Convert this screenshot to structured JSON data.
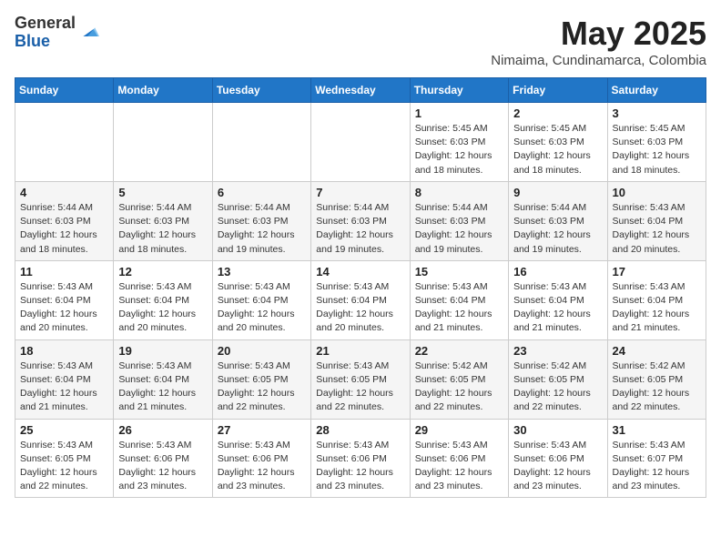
{
  "logo": {
    "general": "General",
    "blue": "Blue"
  },
  "title": "May 2025",
  "location": "Nimaima, Cundinamarca, Colombia",
  "weekdays": [
    "Sunday",
    "Monday",
    "Tuesday",
    "Wednesday",
    "Thursday",
    "Friday",
    "Saturday"
  ],
  "weeks": [
    [
      {
        "day": "",
        "detail": ""
      },
      {
        "day": "",
        "detail": ""
      },
      {
        "day": "",
        "detail": ""
      },
      {
        "day": "",
        "detail": ""
      },
      {
        "day": "1",
        "detail": "Sunrise: 5:45 AM\nSunset: 6:03 PM\nDaylight: 12 hours\nand 18 minutes."
      },
      {
        "day": "2",
        "detail": "Sunrise: 5:45 AM\nSunset: 6:03 PM\nDaylight: 12 hours\nand 18 minutes."
      },
      {
        "day": "3",
        "detail": "Sunrise: 5:45 AM\nSunset: 6:03 PM\nDaylight: 12 hours\nand 18 minutes."
      }
    ],
    [
      {
        "day": "4",
        "detail": "Sunrise: 5:44 AM\nSunset: 6:03 PM\nDaylight: 12 hours\nand 18 minutes."
      },
      {
        "day": "5",
        "detail": "Sunrise: 5:44 AM\nSunset: 6:03 PM\nDaylight: 12 hours\nand 18 minutes."
      },
      {
        "day": "6",
        "detail": "Sunrise: 5:44 AM\nSunset: 6:03 PM\nDaylight: 12 hours\nand 19 minutes."
      },
      {
        "day": "7",
        "detail": "Sunrise: 5:44 AM\nSunset: 6:03 PM\nDaylight: 12 hours\nand 19 minutes."
      },
      {
        "day": "8",
        "detail": "Sunrise: 5:44 AM\nSunset: 6:03 PM\nDaylight: 12 hours\nand 19 minutes."
      },
      {
        "day": "9",
        "detail": "Sunrise: 5:44 AM\nSunset: 6:03 PM\nDaylight: 12 hours\nand 19 minutes."
      },
      {
        "day": "10",
        "detail": "Sunrise: 5:43 AM\nSunset: 6:04 PM\nDaylight: 12 hours\nand 20 minutes."
      }
    ],
    [
      {
        "day": "11",
        "detail": "Sunrise: 5:43 AM\nSunset: 6:04 PM\nDaylight: 12 hours\nand 20 minutes."
      },
      {
        "day": "12",
        "detail": "Sunrise: 5:43 AM\nSunset: 6:04 PM\nDaylight: 12 hours\nand 20 minutes."
      },
      {
        "day": "13",
        "detail": "Sunrise: 5:43 AM\nSunset: 6:04 PM\nDaylight: 12 hours\nand 20 minutes."
      },
      {
        "day": "14",
        "detail": "Sunrise: 5:43 AM\nSunset: 6:04 PM\nDaylight: 12 hours\nand 20 minutes."
      },
      {
        "day": "15",
        "detail": "Sunrise: 5:43 AM\nSunset: 6:04 PM\nDaylight: 12 hours\nand 21 minutes."
      },
      {
        "day": "16",
        "detail": "Sunrise: 5:43 AM\nSunset: 6:04 PM\nDaylight: 12 hours\nand 21 minutes."
      },
      {
        "day": "17",
        "detail": "Sunrise: 5:43 AM\nSunset: 6:04 PM\nDaylight: 12 hours\nand 21 minutes."
      }
    ],
    [
      {
        "day": "18",
        "detail": "Sunrise: 5:43 AM\nSunset: 6:04 PM\nDaylight: 12 hours\nand 21 minutes."
      },
      {
        "day": "19",
        "detail": "Sunrise: 5:43 AM\nSunset: 6:04 PM\nDaylight: 12 hours\nand 21 minutes."
      },
      {
        "day": "20",
        "detail": "Sunrise: 5:43 AM\nSunset: 6:05 PM\nDaylight: 12 hours\nand 22 minutes."
      },
      {
        "day": "21",
        "detail": "Sunrise: 5:43 AM\nSunset: 6:05 PM\nDaylight: 12 hours\nand 22 minutes."
      },
      {
        "day": "22",
        "detail": "Sunrise: 5:42 AM\nSunset: 6:05 PM\nDaylight: 12 hours\nand 22 minutes."
      },
      {
        "day": "23",
        "detail": "Sunrise: 5:42 AM\nSunset: 6:05 PM\nDaylight: 12 hours\nand 22 minutes."
      },
      {
        "day": "24",
        "detail": "Sunrise: 5:42 AM\nSunset: 6:05 PM\nDaylight: 12 hours\nand 22 minutes."
      }
    ],
    [
      {
        "day": "25",
        "detail": "Sunrise: 5:43 AM\nSunset: 6:05 PM\nDaylight: 12 hours\nand 22 minutes."
      },
      {
        "day": "26",
        "detail": "Sunrise: 5:43 AM\nSunset: 6:06 PM\nDaylight: 12 hours\nand 23 minutes."
      },
      {
        "day": "27",
        "detail": "Sunrise: 5:43 AM\nSunset: 6:06 PM\nDaylight: 12 hours\nand 23 minutes."
      },
      {
        "day": "28",
        "detail": "Sunrise: 5:43 AM\nSunset: 6:06 PM\nDaylight: 12 hours\nand 23 minutes."
      },
      {
        "day": "29",
        "detail": "Sunrise: 5:43 AM\nSunset: 6:06 PM\nDaylight: 12 hours\nand 23 minutes."
      },
      {
        "day": "30",
        "detail": "Sunrise: 5:43 AM\nSunset: 6:06 PM\nDaylight: 12 hours\nand 23 minutes."
      },
      {
        "day": "31",
        "detail": "Sunrise: 5:43 AM\nSunset: 6:07 PM\nDaylight: 12 hours\nand 23 minutes."
      }
    ]
  ]
}
